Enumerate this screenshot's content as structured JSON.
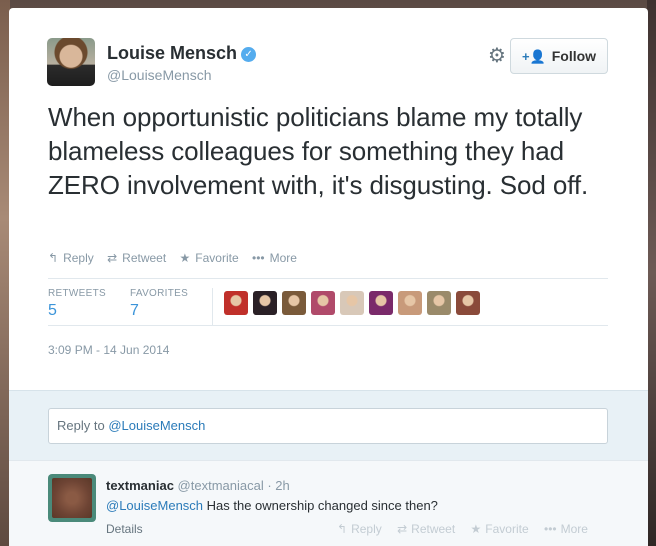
{
  "author": {
    "name": "Louise Mensch",
    "handle": "@LouiseMensch",
    "verified_icon": "✓"
  },
  "follow_button": {
    "icon": "person-add-icon",
    "label": "Follow"
  },
  "tweet": {
    "text": "When opportunistic politicians blame my totally blameless colleagues for something they had ZERO involvement with, it's disgusting. Sod off.",
    "timestamp": "3:09 PM - 14 Jun 2014"
  },
  "actions": {
    "reply": "Reply",
    "retweet": "Retweet",
    "favorite": "Favorite",
    "more": "More"
  },
  "stats": {
    "retweets_label": "RETWEETS",
    "retweets_value": "5",
    "favorites_label": "FAVORITES",
    "favorites_value": "7"
  },
  "favoriters": [
    {
      "color": "#c0302a"
    },
    {
      "color": "#2a2026"
    },
    {
      "color": "#7a5a3a"
    },
    {
      "color": "#b04a6a"
    },
    {
      "color": "#d8c8b8"
    },
    {
      "color": "#7a2a6a"
    },
    {
      "color": "#c89a7a"
    },
    {
      "color": "#9a8a6a"
    },
    {
      "color": "#8a4a3a"
    }
  ],
  "reply_box": {
    "prefix": "Reply to ",
    "mention": "@LouiseMensch"
  },
  "reply": {
    "name": "textmaniac",
    "handle": "@textmaniacal",
    "time": "· 2h",
    "mention": "@LouiseMensch",
    "text": " Has the ownership changed since then?",
    "details": "Details",
    "actions": {
      "reply": "Reply",
      "retweet": "Retweet",
      "favorite": "Favorite",
      "more": "More"
    }
  }
}
